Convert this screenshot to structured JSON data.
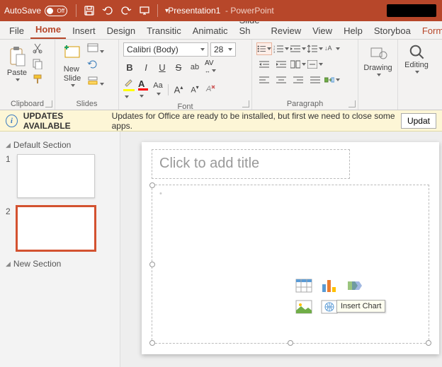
{
  "titlebar": {
    "autosave_label": "AutoSave",
    "autosave_state": "Off",
    "doc_name": "Presentation1",
    "app_name": "PowerPoint"
  },
  "tabs": {
    "file": "File",
    "home": "Home",
    "insert": "Insert",
    "design": "Design",
    "transitions": "Transitic",
    "animations": "Animatic",
    "slideshow": "Slide Sh",
    "review": "Review",
    "view": "View",
    "help": "Help",
    "storyboard": "Storyboa",
    "format": "Format",
    "active": "home"
  },
  "ribbon": {
    "clipboard": {
      "label": "Clipboard",
      "paste": "Paste"
    },
    "slides": {
      "label": "Slides",
      "new_slide": "New\nSlide"
    },
    "font": {
      "label": "Font",
      "name": "Calibri (Body)",
      "size": "28",
      "bold": "B",
      "italic": "I",
      "underline": "U",
      "strike": "S",
      "shadow": "ab",
      "spacing": "AV",
      "case": "Aa",
      "grow": "A",
      "shrink": "A"
    },
    "paragraph": {
      "label": "Paragraph"
    },
    "drawing": {
      "label": "Drawing"
    },
    "editing": {
      "label": "Editing"
    }
  },
  "notify": {
    "title": "UPDATES AVAILABLE",
    "msg": "Updates for Office are ready to be installed, but first we need to close some apps.",
    "button": "Updat"
  },
  "sections": {
    "default": "Default Section",
    "new": "New Section"
  },
  "thumbs": {
    "n1": "1",
    "n2": "2"
  },
  "slide": {
    "title_placeholder": "Click to add title",
    "tooltip": "Insert Chart"
  }
}
